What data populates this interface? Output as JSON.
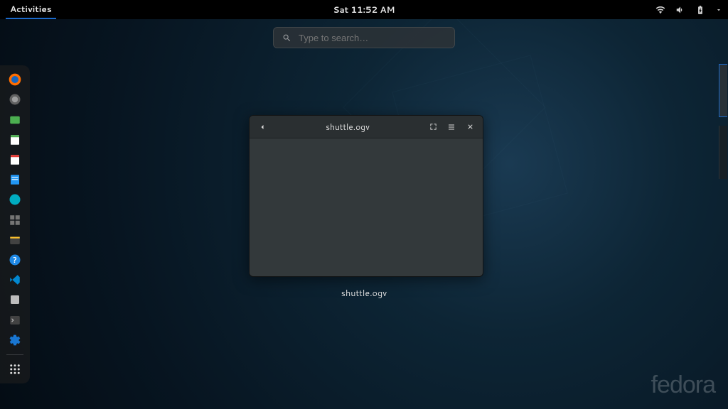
{
  "topbar": {
    "activities_label": "Activities",
    "clock": "Sat 11:52 AM"
  },
  "search": {
    "placeholder": "Type to search…"
  },
  "dash": {
    "items": [
      {
        "name": "firefox",
        "color": "#ff6d00"
      },
      {
        "name": "mail",
        "color": "#9e9e9e"
      },
      {
        "name": "files",
        "color": "#4caf50"
      },
      {
        "name": "libreoffice-writer",
        "color": "#4caf50"
      },
      {
        "name": "libreoffice-impress",
        "color": "#e53935"
      },
      {
        "name": "text-editor",
        "color": "#2196f3"
      },
      {
        "name": "software",
        "color": "#00acc1"
      },
      {
        "name": "boxes",
        "color": "#757575"
      },
      {
        "name": "archive",
        "color": "#fbc02d"
      },
      {
        "name": "help",
        "color": "#1e88e5"
      },
      {
        "name": "vscode",
        "color": "#0288d1"
      },
      {
        "name": "disks",
        "color": "#bdbdbd"
      },
      {
        "name": "terminal",
        "color": "#bdbdbd"
      },
      {
        "name": "settings",
        "color": "#1976d2"
      }
    ],
    "apps_label": "Show Applications"
  },
  "window": {
    "title": "shuttle.ogv",
    "caption": "shuttle.ogv"
  },
  "branding": {
    "distro": "fedora"
  }
}
